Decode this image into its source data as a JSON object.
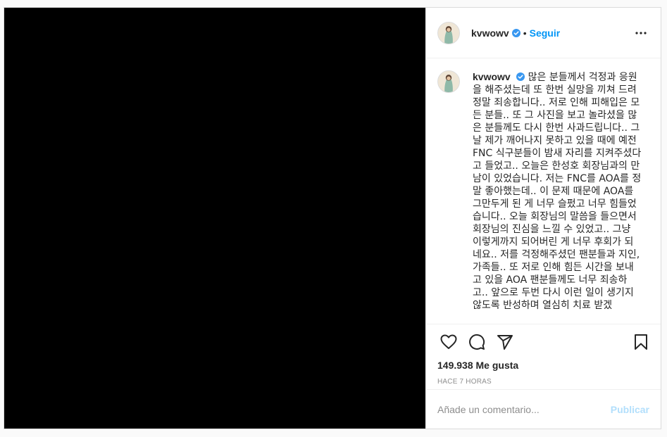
{
  "post": {
    "author": {
      "username": "kvwowv",
      "verified": true,
      "verified_color": "#3897f0"
    },
    "header": {
      "separator": "•",
      "follow_label": "Seguir",
      "follow_color": "#0095f6"
    },
    "caption": "많은 분들께서 걱정과 응원을 해주셨는데 또 한번 실망을 끼쳐 드려 정말 죄송합니다.. 저로 인해 피해입은 모든 분들.. 또 그 사진을 보고 놀라셨을 많은 분들께도 다시 한번 사과드립니다.. 그날 제가 깨어나지 못하고 있을 때에 예전 FNC 식구분들이 밤새 자리를 지켜주셨다고 들었고.. 오늘은 한성호 회장님과의 만남이 있었습니다. 저는 FNC를 AOA를 정말 좋아했는데.. 이 문제 때문에 AOA를 그만두게 된 게 너무 슬펐고 너무 힘들었습니다.. 오늘 회장님의 말씀을 들으면서 회장님의 진심을 느낄 수 있었고.. 그냥 이렇게까지 되어버린 게 너무 후회가 되네요.. 저를 걱정해주셨던 팬분들과 지인, 가족들.. 또 저로 인해 힘든 시간을 보내고 있을 AOA 팬분들께도 너무 죄송하고.. 앞으로 두번 다시 이런 일이 생기지 않도록 반성하며 열심히 치료 받겠",
    "likes": "149.938 Me gusta",
    "time": "HACE 7 HORAS",
    "comment_placeholder": "Añade un comentario...",
    "publish_label": "Publicar",
    "publish_color": "#b2dffc",
    "icons": {
      "more": "more-options-icon",
      "like": "heart-icon",
      "comment": "comment-icon",
      "share": "paper-plane-icon",
      "save": "bookmark-icon"
    }
  }
}
